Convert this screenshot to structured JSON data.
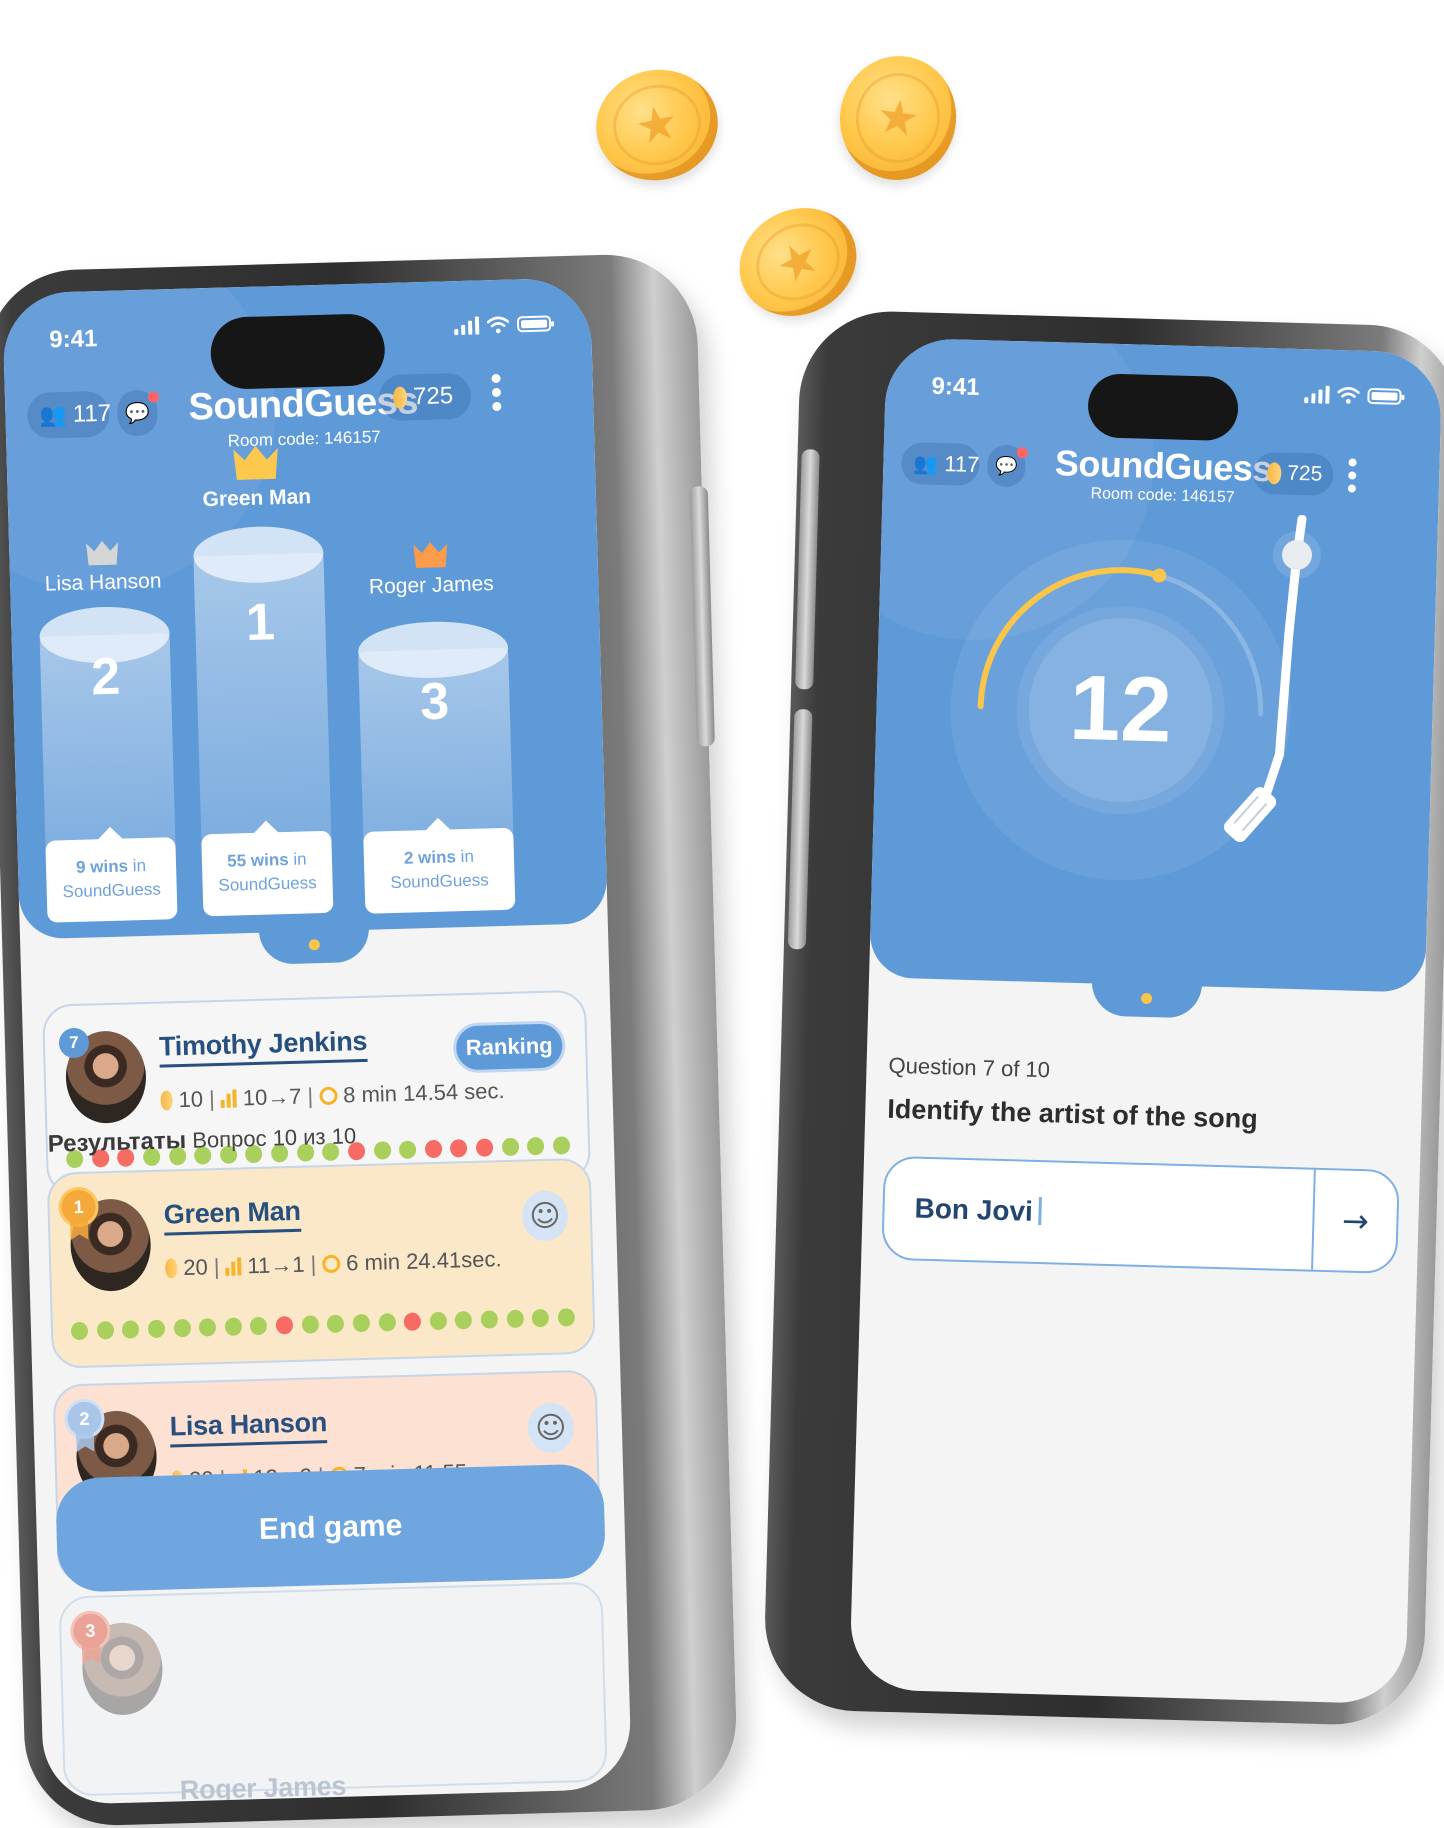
{
  "coins_decor": [
    {
      "name": "floating-coin-1"
    },
    {
      "name": "floating-coin-2"
    },
    {
      "name": "floating-coin-3"
    }
  ],
  "status_bar": {
    "time": "9:41"
  },
  "app": {
    "title": "SoundGuess",
    "room_code": "Room code: 146157",
    "players_count": "117",
    "coins": "725",
    "chat_has_unread": true
  },
  "results_screen": {
    "podium": [
      {
        "place": "2",
        "name": "Lisa Hanson",
        "wins_bold": "9 wins",
        "wins_rest": " in",
        "game": "SoundGuess",
        "crown": "silver"
      },
      {
        "place": "1",
        "name": "Green Man",
        "wins_bold": "55 wins",
        "wins_rest": " in",
        "game": "SoundGuess",
        "crown": "gold"
      },
      {
        "place": "3",
        "name": "Roger James",
        "wins_bold": "2 wins",
        "wins_rest": " in",
        "game": "SoundGuess",
        "crown": "bronze"
      }
    ],
    "current_player": {
      "rank": "7",
      "name": "Timothy Jenkins",
      "coins": "10",
      "position_change": "10→7",
      "time": "8 min 14.54 sec.",
      "ranking_button": "Ranking",
      "answers": [
        "g",
        "r",
        "r",
        "g",
        "g",
        "g",
        "g",
        "g",
        "g",
        "g",
        "g",
        "r",
        "g",
        "g",
        "r",
        "r",
        "r",
        "g",
        "g",
        "g"
      ]
    },
    "results_heading_bold": "Результаты",
    "results_heading_rest": "Вопрос 10 из 10",
    "results": [
      {
        "place": "1",
        "medal": "gold",
        "name": "Green Man",
        "coins": "20",
        "position_change": "11→1",
        "time": "6 min 24.41sec.",
        "answers": [
          "g",
          "g",
          "g",
          "g",
          "g",
          "g",
          "g",
          "g",
          "r",
          "g",
          "g",
          "g",
          "g",
          "r",
          "g",
          "g",
          "g",
          "g",
          "g",
          "g"
        ],
        "bg": "#fbe8c8"
      },
      {
        "place": "2",
        "medal": "silver",
        "name": "Lisa Hanson",
        "coins": "20",
        "position_change": "12→2",
        "time": "7 min 11.55 sec.",
        "bg": "#fde1d2"
      },
      {
        "place": "3",
        "medal": "bronze",
        "name": "Roger James"
      }
    ],
    "end_game_button": "End game"
  },
  "question_screen": {
    "timer_value": "12",
    "timer_progress_fraction": 0.58,
    "question_counter": "Question 7 of 10",
    "prompt": "Identify the artist of the song",
    "answer_value": "Bon Jovi",
    "submit_icon": "→"
  },
  "colors": {
    "primary_blue": "#5f9ad8",
    "accent_yellow": "#f9c54a",
    "correct_green": "#a9d05c",
    "wrong_red": "#f66b63",
    "name_navy": "#27507f"
  }
}
